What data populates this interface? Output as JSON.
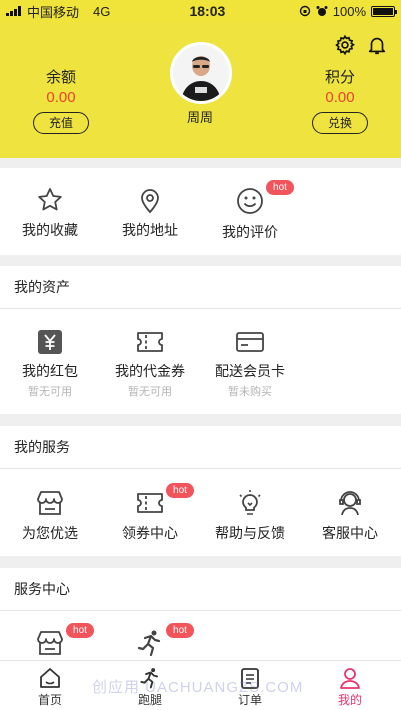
{
  "status_bar": {
    "carrier": "中国移动",
    "network": "4G",
    "time": "18:03",
    "battery": "100%",
    "battery_level": 1.0
  },
  "header": {
    "balance_label": "余额",
    "balance_value": "0.00",
    "recharge_button": "充值",
    "points_label": "积分",
    "points_value": "0.00",
    "redeem_button": "兑换",
    "username": "周周",
    "background_color": "#eee33f",
    "value_color": "#e8442e"
  },
  "quick_links": [
    {
      "label": "我的收藏",
      "icon": "star-icon"
    },
    {
      "label": "我的地址",
      "icon": "location-pin-icon"
    },
    {
      "label": "我的评价",
      "icon": "smile-icon",
      "badge": "hot"
    }
  ],
  "assets": {
    "title": "我的资产",
    "items": [
      {
        "label": "我的红包",
        "sub": "暂无可用",
        "icon": "red-packet-icon"
      },
      {
        "label": "我的代金券",
        "sub": "暂无可用",
        "icon": "coupon-icon"
      },
      {
        "label": "配送会员卡",
        "sub": "暂未购买",
        "icon": "member-card-icon"
      }
    ]
  },
  "services": {
    "title": "我的服务",
    "items": [
      {
        "label": "为您优选",
        "icon": "shop-icon"
      },
      {
        "label": "领券中心",
        "icon": "coupon-icon",
        "badge": "hot"
      },
      {
        "label": "帮助与反馈",
        "icon": "lightbulb-icon"
      },
      {
        "label": "客服中心",
        "icon": "headset-icon"
      }
    ]
  },
  "service_center": {
    "title": "服务中心",
    "items": [
      {
        "label": "",
        "icon": "shop-icon",
        "badge": "hot"
      },
      {
        "label": "",
        "icon": "runner-icon",
        "badge": "hot"
      }
    ]
  },
  "tabbar": [
    {
      "label": "首页",
      "icon": "home-icon"
    },
    {
      "label": "跑腿",
      "icon": "runner-icon"
    },
    {
      "label": "订单",
      "icon": "order-list-icon"
    },
    {
      "label": "我的",
      "icon": "user-icon",
      "active": true
    }
  ],
  "watermark": "创应用 UACHUANGZS.COM",
  "accent_color": "#e8336e",
  "badge_color": "#f2545b"
}
